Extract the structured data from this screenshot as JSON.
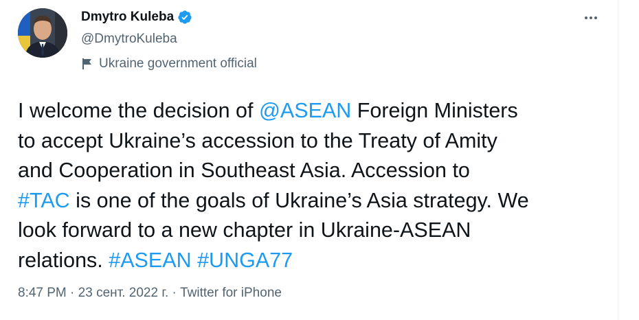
{
  "author": {
    "display_name": "Dmytro Kuleba",
    "handle": "@DmytroKuleba",
    "verified_icon": "verified-badge-icon",
    "label": "Ukraine government official",
    "label_icon": "flag-icon"
  },
  "tweet": {
    "lines": [
      [
        {
          "text": "I welcome the decision of ",
          "type": "text"
        },
        {
          "text": "@ASEAN",
          "type": "mention"
        },
        {
          "text": " Foreign Ministers",
          "type": "text"
        }
      ],
      [
        {
          "text": "to accept Ukraine’s accession to the Treaty of Amity",
          "type": "text"
        }
      ],
      [
        {
          "text": "and Cooperation in Southeast Asia. Accession to",
          "type": "text"
        }
      ],
      [
        {
          "text": "#TAC",
          "type": "hashtag"
        },
        {
          "text": " is one of the goals of Ukraine’s Asia strategy. We",
          "type": "text"
        }
      ],
      [
        {
          "text": "look forward to a new chapter in Ukraine-ASEAN",
          "type": "text"
        }
      ],
      [
        {
          "text": "relations. ",
          "type": "text"
        },
        {
          "text": "#ASEAN",
          "type": "hashtag"
        },
        {
          "text": " ",
          "type": "text"
        },
        {
          "text": "#UNGA77",
          "type": "hashtag"
        }
      ]
    ]
  },
  "meta": {
    "time": "8:47 PM",
    "separator": " · ",
    "date": "23 сент. 2022 г.",
    "source": "Twitter for iPhone"
  },
  "menu": {
    "icon": "more-horizontal-icon"
  },
  "colors": {
    "link": "#1d9bf0",
    "text": "#0f1419",
    "secondary": "#536471",
    "verified": "#1d9bf0"
  }
}
